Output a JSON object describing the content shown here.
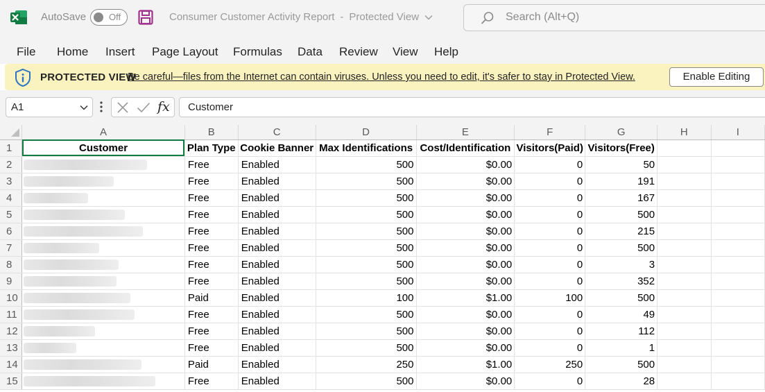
{
  "titlebar": {
    "autosave_label": "AutoSave",
    "autosave_state": "Off",
    "document_title": "Consumer Customer Activity Report",
    "view_mode": "Protected View",
    "search_placeholder": "Search (Alt+Q)"
  },
  "menu": {
    "items": [
      "File",
      "Home",
      "Insert",
      "Page Layout",
      "Formulas",
      "Data",
      "Review",
      "View",
      "Help"
    ]
  },
  "protected_view": {
    "title": "PROTECTED VIEW",
    "message": "Be careful—files from the Internet can contain viruses. Unless you need to edit, it's safer to stay in Protected View.",
    "button_label": "Enable Editing"
  },
  "formula_bar": {
    "name_box": "A1",
    "fx_label": "fx",
    "content": "Customer"
  },
  "grid": {
    "column_letters": [
      "A",
      "B",
      "C",
      "D",
      "E",
      "F",
      "G",
      "H",
      "I"
    ],
    "header_row": [
      "Customer",
      "Plan Type",
      "Cookie Banner",
      "Max Identifications",
      "Cost/Identification",
      "Visitors(Paid)",
      "Visitors(Free)"
    ],
    "rows": [
      {
        "n": "1"
      },
      {
        "n": "2",
        "plan": "Free",
        "banner": "Enabled",
        "max": "500",
        "cost": "$0.00",
        "paid": "0",
        "free": "50"
      },
      {
        "n": "3",
        "plan": "Free",
        "banner": "Enabled",
        "max": "500",
        "cost": "$0.00",
        "paid": "0",
        "free": "191"
      },
      {
        "n": "4",
        "plan": "Free",
        "banner": "Enabled",
        "max": "500",
        "cost": "$0.00",
        "paid": "0",
        "free": "167"
      },
      {
        "n": "5",
        "plan": "Free",
        "banner": "Enabled",
        "max": "500",
        "cost": "$0.00",
        "paid": "0",
        "free": "500"
      },
      {
        "n": "6",
        "plan": "Free",
        "banner": "Enabled",
        "max": "500",
        "cost": "$0.00",
        "paid": "0",
        "free": "215"
      },
      {
        "n": "7",
        "plan": "Free",
        "banner": "Enabled",
        "max": "500",
        "cost": "$0.00",
        "paid": "0",
        "free": "500"
      },
      {
        "n": "8",
        "plan": "Free",
        "banner": "Enabled",
        "max": "500",
        "cost": "$0.00",
        "paid": "0",
        "free": "3"
      },
      {
        "n": "9",
        "plan": "Free",
        "banner": "Enabled",
        "max": "500",
        "cost": "$0.00",
        "paid": "0",
        "free": "352"
      },
      {
        "n": "10",
        "plan": "Paid",
        "banner": "Enabled",
        "max": "100",
        "cost": "$1.00",
        "paid": "100",
        "free": "500"
      },
      {
        "n": "11",
        "plan": "Free",
        "banner": "Enabled",
        "max": "500",
        "cost": "$0.00",
        "paid": "0",
        "free": "49"
      },
      {
        "n": "12",
        "plan": "Free",
        "banner": "Enabled",
        "max": "500",
        "cost": "$0.00",
        "paid": "0",
        "free": "112"
      },
      {
        "n": "13",
        "plan": "Free",
        "banner": "Enabled",
        "max": "500",
        "cost": "$0.00",
        "paid": "0",
        "free": "1"
      },
      {
        "n": "14",
        "plan": "Paid",
        "banner": "Enabled",
        "max": "250",
        "cost": "$1.00",
        "paid": "250",
        "free": "500"
      },
      {
        "n": "15",
        "plan": "Free",
        "banner": "Enabled",
        "max": "500",
        "cost": "$0.00",
        "paid": "0",
        "free": "28"
      }
    ]
  },
  "colors": {
    "excel_green": "#107c41",
    "protected_bar": "#fbf3bf",
    "save_icon_purple": "#a0328c",
    "chrome_gray": "#f3f3f3"
  },
  "icons": [
    "excel-app-icon",
    "save-icon",
    "search-icon",
    "shield-info-icon",
    "chevron-down-icon",
    "more-vertical-icon",
    "cancel-x-icon",
    "check-icon"
  ]
}
